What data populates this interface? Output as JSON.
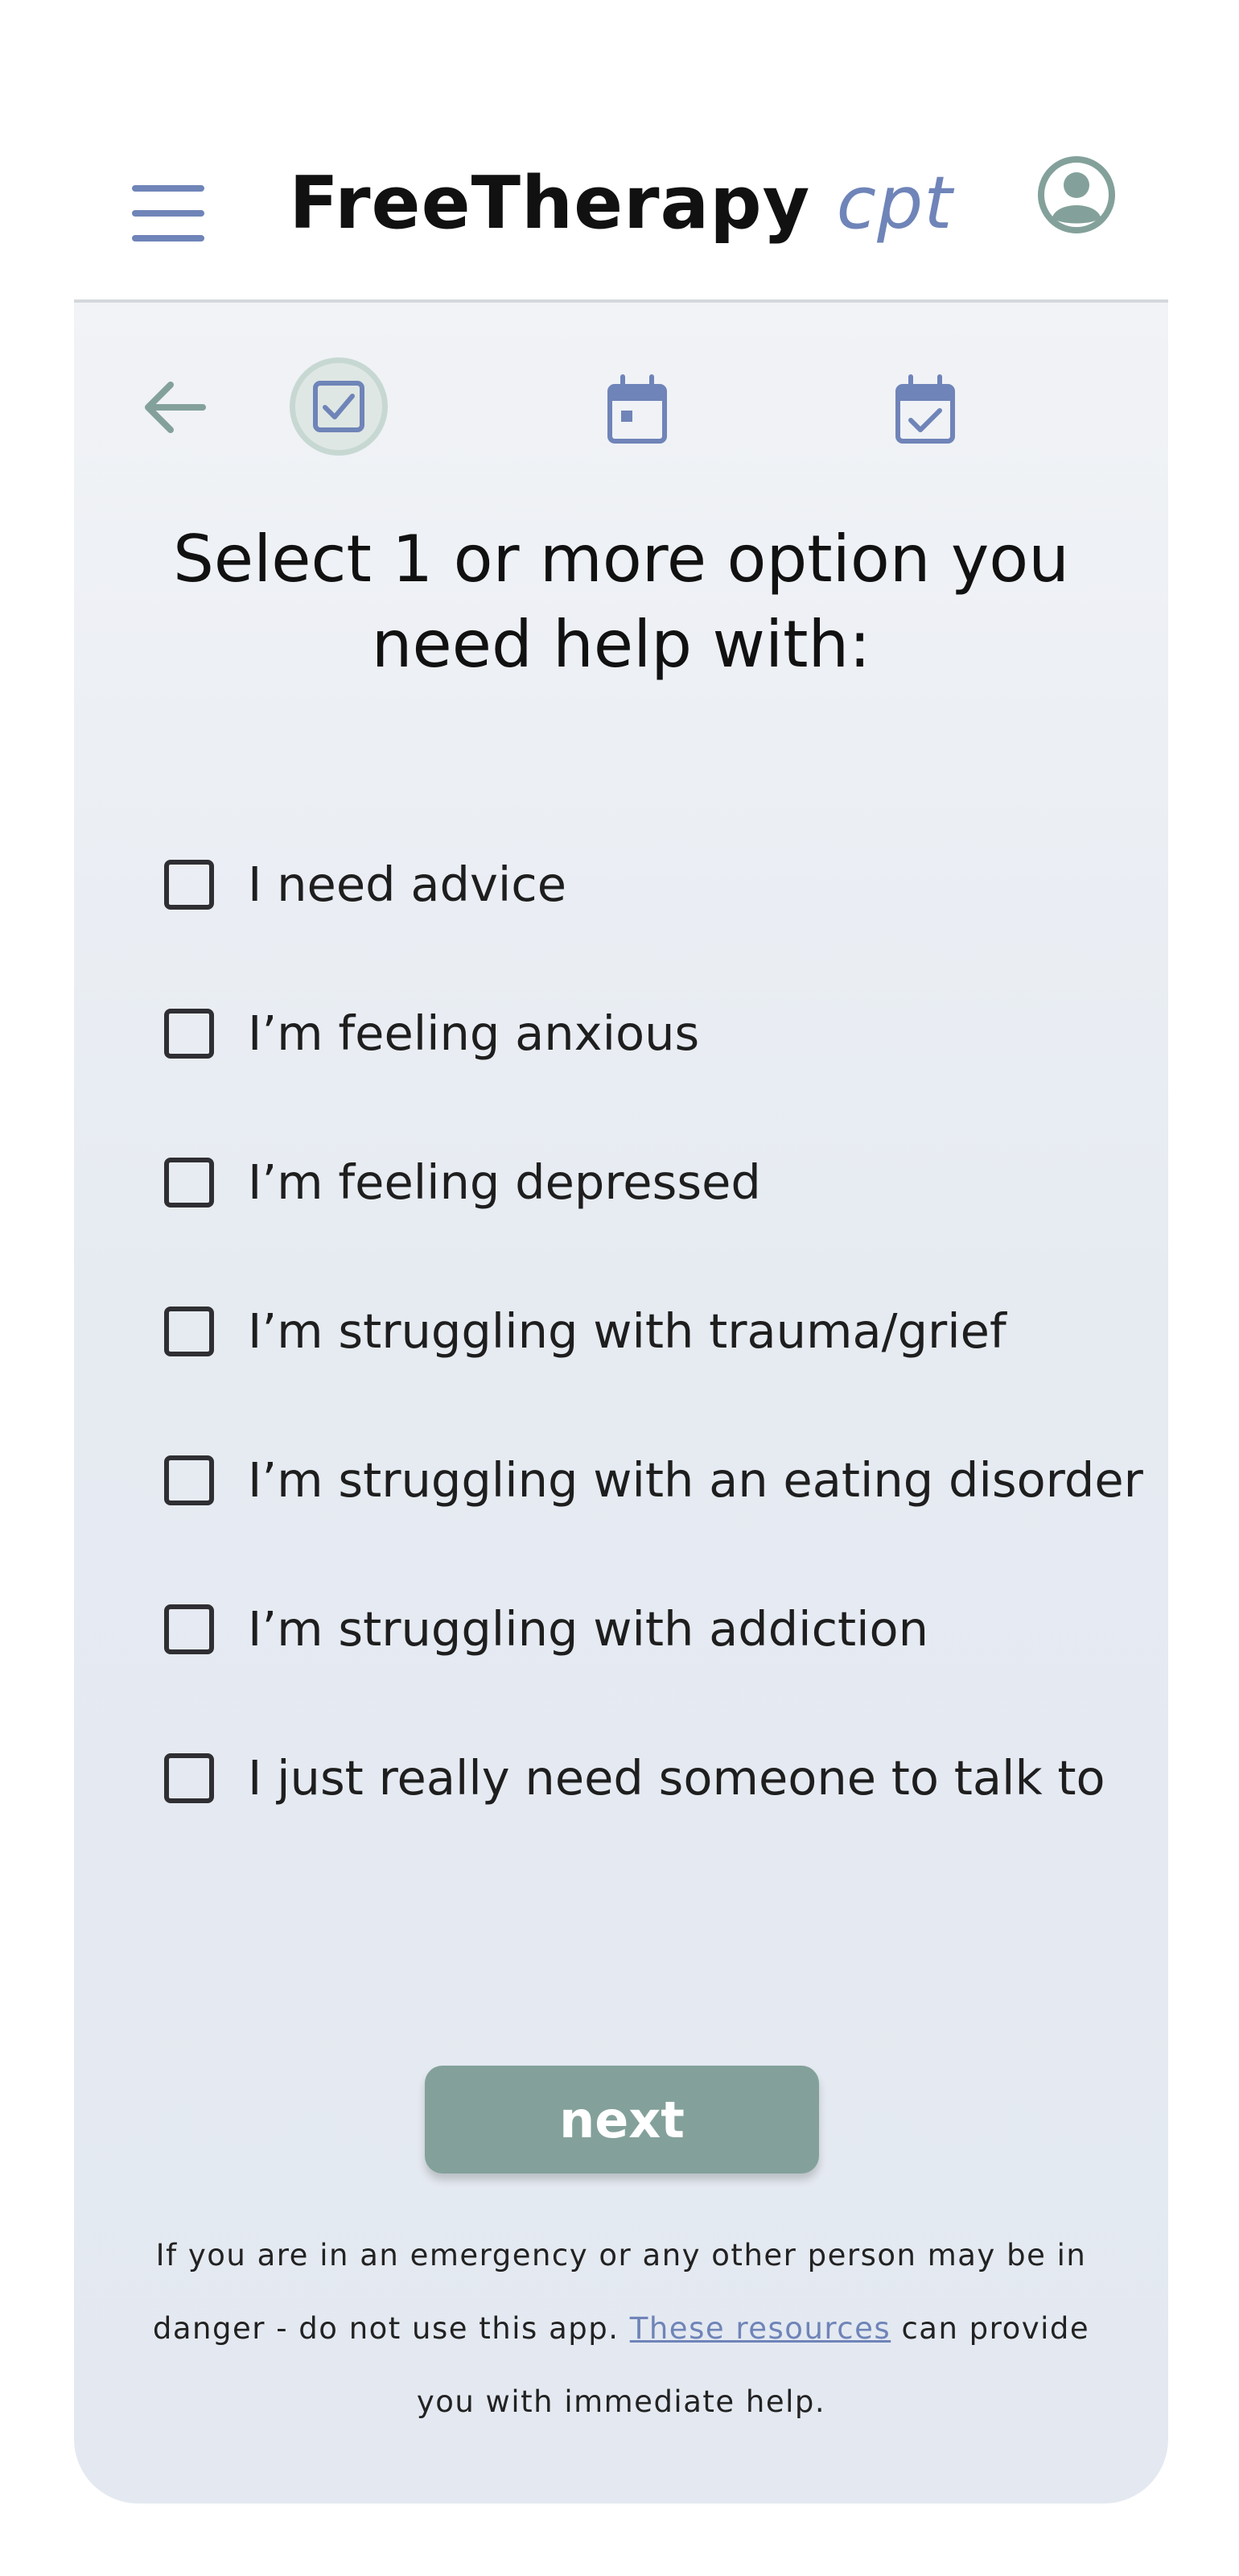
{
  "header": {
    "title_main": "FreeTherapy",
    "title_suffix": "cpt"
  },
  "icons": {
    "menu": "hamburger-icon",
    "profile": "user-circle-icon",
    "back": "arrow-left-icon",
    "step_1": "checkbox-checked-icon",
    "step_2": "calendar-icon",
    "step_3": "calendar-check-icon"
  },
  "colors": {
    "accent_blue": "#6f84b8",
    "accent_green": "#83a19a",
    "text": "#1e1e1e"
  },
  "question": {
    "line1": "Select 1 or more option you",
    "line2": "need help with:"
  },
  "options": [
    {
      "label": "I need advice",
      "checked": false
    },
    {
      "label": "I’m feeling anxious",
      "checked": false
    },
    {
      "label": "I’m feeling depressed",
      "checked": false
    },
    {
      "label": "I’m struggling with trauma/grief",
      "checked": false
    },
    {
      "label": "I’m struggling with an eating disorder",
      "checked": false
    },
    {
      "label": "I’m struggling with addiction",
      "checked": false
    },
    {
      "label": "I just really need someone to talk to",
      "checked": false
    }
  ],
  "next_button": {
    "label": "next"
  },
  "disclaimer": {
    "part1": "If you are in an emergency or any other person may be in danger - do not use this app.",
    "link": "These resources",
    "part2": "can provide you with immediate help."
  }
}
